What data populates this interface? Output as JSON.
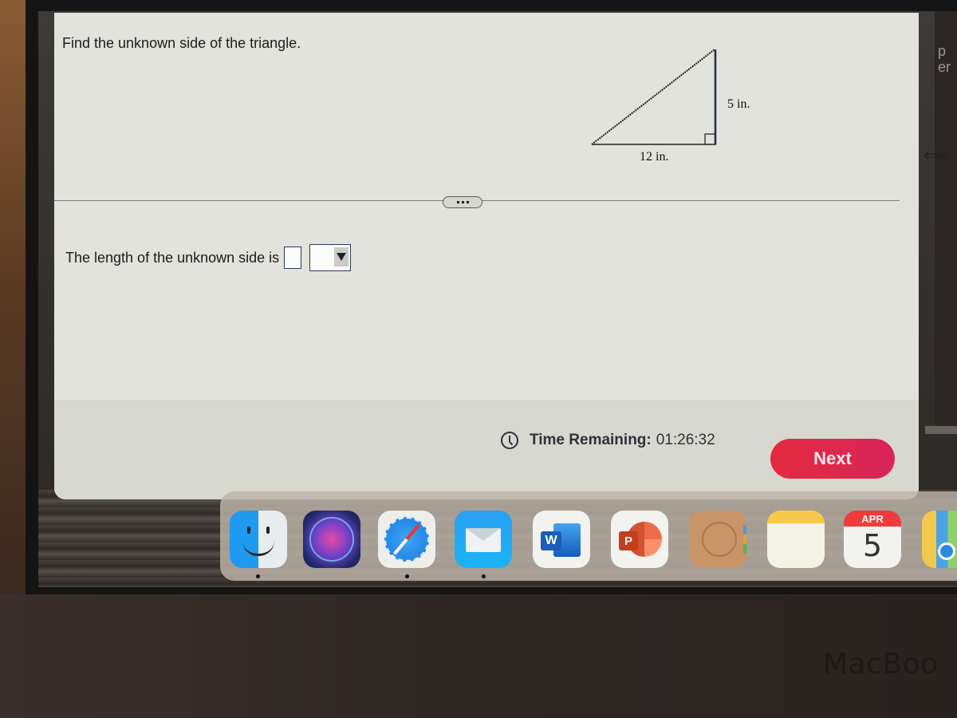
{
  "question": {
    "prompt": "Find the unknown side of the triangle.",
    "figure": {
      "shape": "right-triangle",
      "vertical_leg_label": "5 in.",
      "horizontal_leg_label": "12 in."
    },
    "more_button_label": "...",
    "answer": {
      "label": "The length of the unknown side is",
      "value": "",
      "unit_selected": ""
    }
  },
  "footer": {
    "timer_label": "Time Remaining:",
    "timer_value": "01:26:32",
    "next_label": "Next",
    "accent_color": "#e22a48"
  },
  "side_window": {
    "text_lines": [
      "p",
      "er"
    ]
  },
  "dock": {
    "items": [
      {
        "name": "Finder",
        "icon": "finder-icon",
        "running": true
      },
      {
        "name": "Siri",
        "icon": "siri-icon",
        "running": false
      },
      {
        "name": "Safari",
        "icon": "safari-icon",
        "running": true
      },
      {
        "name": "Mail",
        "icon": "mail-icon",
        "running": true
      },
      {
        "name": "Microsoft Word",
        "icon": "word-icon",
        "badge": "W",
        "running": false
      },
      {
        "name": "Microsoft PowerPoint",
        "icon": "powerpoint-icon",
        "badge": "P",
        "running": false
      },
      {
        "name": "Contacts",
        "icon": "contacts-icon",
        "running": false
      },
      {
        "name": "Notes",
        "icon": "notes-icon",
        "running": false
      },
      {
        "name": "Calendar",
        "icon": "calendar-icon",
        "month": "APR",
        "day": "5",
        "running": false
      },
      {
        "name": "Maps",
        "icon": "maps-icon",
        "running": true
      }
    ]
  },
  "device": {
    "brand_text": "MacBoo"
  }
}
